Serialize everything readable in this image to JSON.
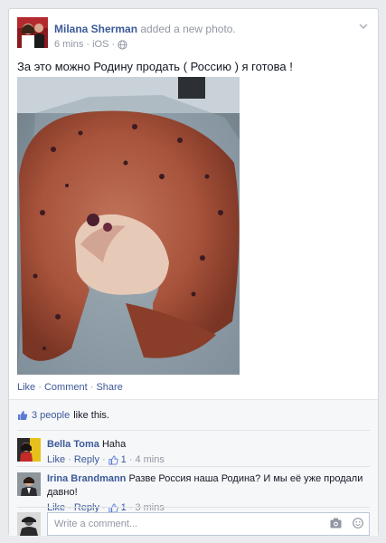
{
  "post": {
    "author": "Milana Sherman",
    "action": "added a new photo.",
    "time": "6 mins",
    "separator": "·",
    "platform": "iOS",
    "text": "За это можно Родину продать ( Россию ) я готова !",
    "actions": {
      "like": "Like",
      "comment": "Comment",
      "share": "Share",
      "sep": "·"
    }
  },
  "likes": {
    "count": "3 people",
    "suffix": "like this."
  },
  "comments": [
    {
      "author": "Bella Toma",
      "text": "Haha",
      "like": "Like",
      "reply": "Reply",
      "sep": "·",
      "likes": "1",
      "time": "4 mins"
    },
    {
      "author": "Irina Brandmann",
      "text": "Разве Россия наша Родина? И мы её уже продали давно!",
      "like": "Like",
      "reply": "Reply",
      "sep": "·",
      "likes": "1",
      "time": "3 mins"
    }
  ],
  "composer": {
    "placeholder": "Write a comment..."
  },
  "colors": {
    "link": "#3b5998",
    "muted": "#9197a3",
    "background": "#e9ebee"
  },
  "icons": [
    "globe-icon",
    "chevron-down-icon",
    "thumbs-up-icon",
    "camera-icon",
    "smiley-icon"
  ]
}
